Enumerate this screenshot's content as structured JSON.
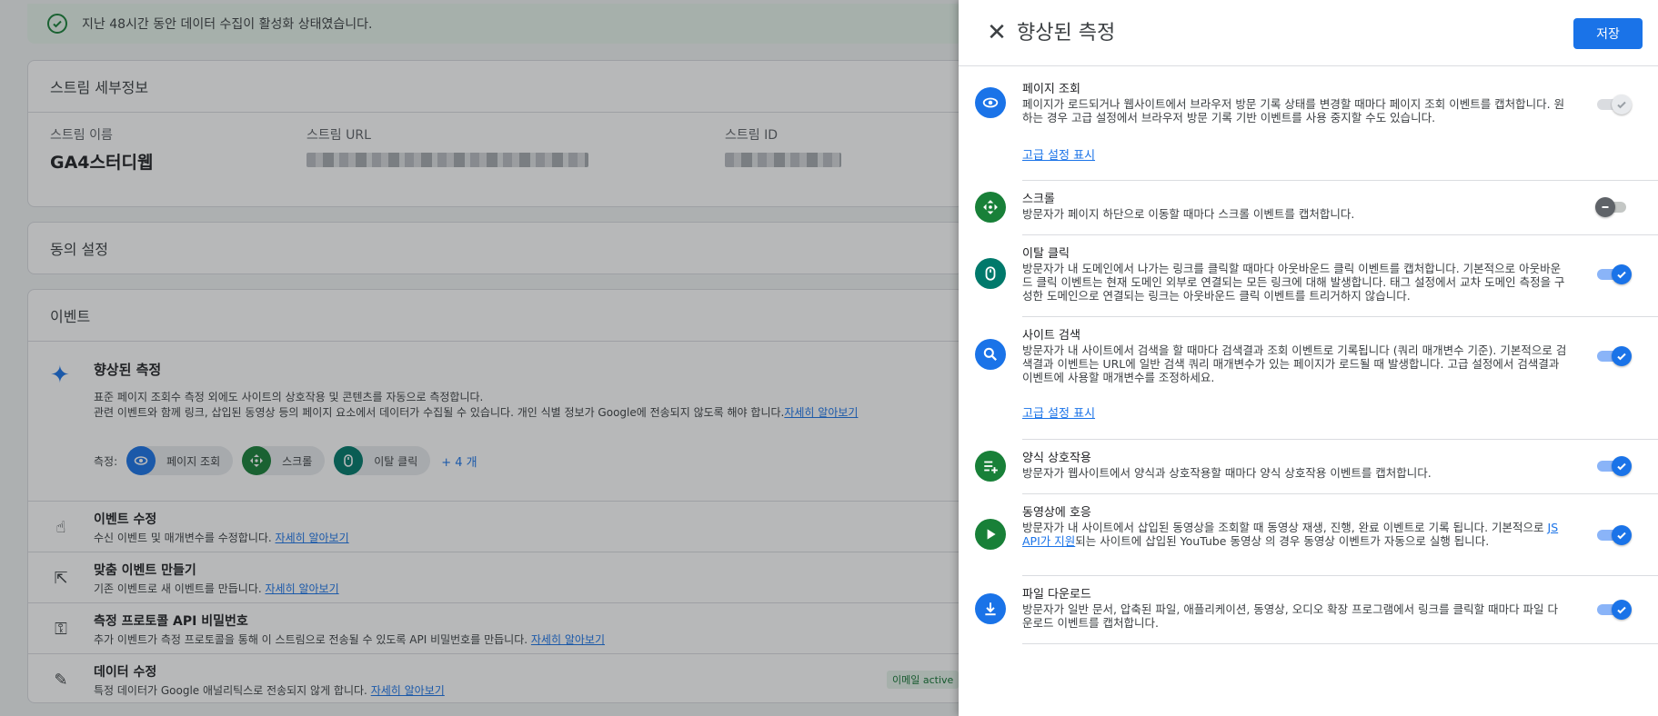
{
  "background": {
    "banner_text": "지난 48시간 동안 데이터 수집이 활성화 상태였습니다.",
    "stream_details": {
      "title": "스트림 세부정보",
      "name_label": "스트림 이름",
      "name_value": "GA4스터디웹",
      "url_label": "스트림 URL",
      "id_label": "스트림 ID"
    },
    "consent_title": "동의 설정",
    "events": {
      "title": "이벤트",
      "enhanced": {
        "title": "향상된 측정",
        "desc1": "표준 페이지 조회수 측정 외에도 사이트의 상호작용 및 콘텐츠를 자동으로 측정합니다.",
        "desc2": "관련 이벤트와 함께 링크, 삽입된 동영상 등의 페이지 요소에서 데이터가 수집될 수 있습니다. 개인 식별 정보가 Google에 전송되지 않도록 해야 합니다.",
        "learn_more": "자세히 알아보기",
        "measure_label": "측정:",
        "chips": [
          "페이지 조회",
          "스크롤",
          "이탈 클릭"
        ],
        "more": "+ 4 개"
      },
      "rows": [
        {
          "title": "이벤트 수정",
          "desc": "수신 이벤트 및 매개변수를 수정합니다.",
          "link": "자세히 알아보기"
        },
        {
          "title": "맞춤 이벤트 만들기",
          "desc": "기존 이벤트로 새 이벤트를 만듭니다.",
          "link": "자세히 알아보기"
        },
        {
          "title": "측정 프로토콜 API 비밀번호",
          "desc": "추가 이벤트가 측정 프로토콜을 통해 이 스트림으로 전송될 수 있도록 API 비밀번호를 만듭니다.",
          "link": "자세히 알아보기"
        },
        {
          "title": "데이터 수정",
          "desc": "특정 데이터가 Google 애널리틱스로 전송되지 않게 합니다.",
          "link": "자세히 알아보기",
          "badge": "이메일 active"
        }
      ]
    }
  },
  "panel": {
    "title": "향상된 측정",
    "save_label": "저장",
    "advanced_link": "고급 설정 표시",
    "items": [
      {
        "title": "페이지 조회",
        "desc": "페이지가 로드되거나 웹사이트에서 브라우저 방문 기록 상태를 변경할 때마다 페이지 조회 이벤트를 캡처합니다. 원하는 경우 고급 설정에서 브라우저 방문 기록 기반 이벤트를 사용 중지할 수도 있습니다.",
        "state": "on-disabled"
      },
      {
        "title": "스크롤",
        "desc": "방문자가 페이지 하단으로 이동할 때마다 스크롤 이벤트를 캡처합니다.",
        "state": "off"
      },
      {
        "title": "이탈 클릭",
        "desc": "방문자가 내 도메인에서 나가는 링크를 클릭할 때마다 아웃바운드 클릭 이벤트를 캡처합니다. 기본적으로 아웃바운드 클릭 이벤트는 현재 도메인 외부로 연결되는 모든 링크에 대해 발생합니다. 태그 설정에서 교차 도메인 측정을 구성한 도메인으로 연결되는 링크는 아웃바운드 클릭 이벤트를 트리거하지 않습니다.",
        "state": "on"
      },
      {
        "title": "사이트 검색",
        "desc": "방문자가 내 사이트에서 검색을 할 때마다 검색결과 조회 이벤트로 기록됩니다 (쿼리 매개변수 기준). 기본적으로 검색결과 이벤트는 URL에 일반 검색 쿼리 매개변수가 있는 페이지가 로드될 때 발생합니다. 고급 설정에서 검색결과 이벤트에 사용할 매개변수를 조정하세요.",
        "state": "on"
      },
      {
        "title": "양식 상호작용",
        "desc": "방문자가 웹사이트에서 양식과 상호작용할 때마다 양식 상호작용 이벤트를 캡처합니다.",
        "state": "on"
      },
      {
        "title": "동영상에 호응",
        "desc_a": "방문자가 내 사이트에서 삽입된 동영상을 조회할 때 동영상 재생, 진행, 완료 이벤트로 기록 됩니다. 기본적으로 ",
        "link": "JS API가 지원",
        "desc_b": "되는 사이트에 삽입된 YouTube 동영상 의 경우 동영상 이벤트가 자동으로 실행 됩니다.",
        "state": "on"
      },
      {
        "title": "파일 다운로드",
        "desc": "방문자가 일반 문서, 압축된 파일, 애플리케이션, 동영상, 오디오 확장 프로그램에서 링크를 클릭할 때마다 파일 다운로드 이벤트를 캡처합니다.",
        "state": "on"
      }
    ]
  },
  "colors": {
    "blue": "#1a73e8",
    "green": "#188038",
    "teal": "#00796b"
  }
}
